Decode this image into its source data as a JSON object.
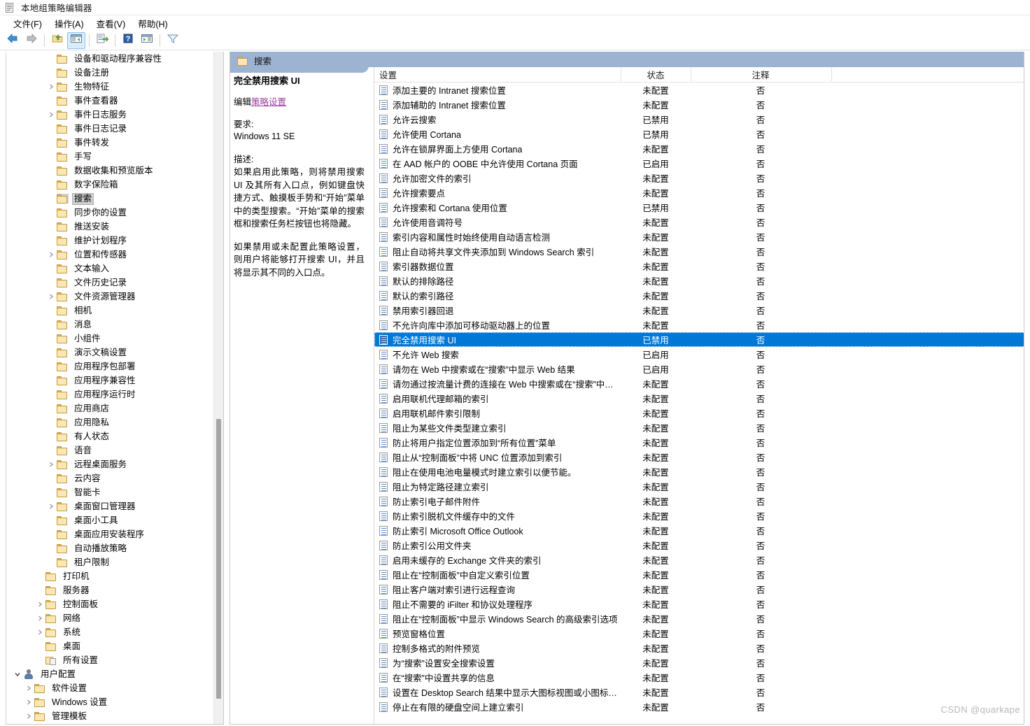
{
  "window": {
    "title": "本地组策略编辑器",
    "title_icon": "policy-editor-icon"
  },
  "menubar": {
    "items": [
      {
        "label": "文件(F)",
        "name": "menu-file"
      },
      {
        "label": "操作(A)",
        "name": "menu-action"
      },
      {
        "label": "查看(V)",
        "name": "menu-view"
      },
      {
        "label": "帮助(H)",
        "name": "menu-help"
      }
    ]
  },
  "toolbar": {
    "buttons": [
      {
        "icon": "back-arrow-icon",
        "name": "toolbar-back"
      },
      {
        "icon": "forward-arrow-icon",
        "name": "toolbar-forward"
      },
      {
        "icon": "up-folder-icon",
        "name": "toolbar-up-level"
      },
      {
        "icon": "show-hide-tree-icon",
        "name": "toolbar-show-hide-tree",
        "active": true
      },
      {
        "icon": "export-list-icon",
        "name": "toolbar-export-list"
      },
      {
        "icon": "help-icon",
        "name": "toolbar-help"
      },
      {
        "icon": "properties-icon",
        "name": "toolbar-properties"
      },
      {
        "icon": "filter-icon",
        "name": "toolbar-filter"
      }
    ]
  },
  "tree": {
    "items": [
      {
        "label": "设备和驱动程序兼容性",
        "indent": 3,
        "expandable": false,
        "icon": "folder-icon"
      },
      {
        "label": "设备注册",
        "indent": 3,
        "expandable": false,
        "icon": "folder-icon"
      },
      {
        "label": "生物特征",
        "indent": 3,
        "expandable": true,
        "icon": "folder-icon"
      },
      {
        "label": "事件查看器",
        "indent": 3,
        "expandable": false,
        "icon": "folder-icon"
      },
      {
        "label": "事件日志服务",
        "indent": 3,
        "expandable": true,
        "icon": "folder-icon"
      },
      {
        "label": "事件日志记录",
        "indent": 3,
        "expandable": false,
        "icon": "folder-icon"
      },
      {
        "label": "事件转发",
        "indent": 3,
        "expandable": false,
        "icon": "folder-icon"
      },
      {
        "label": "手写",
        "indent": 3,
        "expandable": false,
        "icon": "folder-icon"
      },
      {
        "label": "数据收集和预览版本",
        "indent": 3,
        "expandable": false,
        "icon": "folder-icon"
      },
      {
        "label": "数字保险箱",
        "indent": 3,
        "expandable": false,
        "icon": "folder-icon"
      },
      {
        "label": "搜索",
        "indent": 3,
        "expandable": false,
        "icon": "folder-icon",
        "selected": true
      },
      {
        "label": "同步你的设置",
        "indent": 3,
        "expandable": false,
        "icon": "folder-icon"
      },
      {
        "label": "推送安装",
        "indent": 3,
        "expandable": false,
        "icon": "folder-icon"
      },
      {
        "label": "维护计划程序",
        "indent": 3,
        "expandable": false,
        "icon": "folder-icon"
      },
      {
        "label": "位置和传感器",
        "indent": 3,
        "expandable": true,
        "icon": "folder-icon"
      },
      {
        "label": "文本输入",
        "indent": 3,
        "expandable": false,
        "icon": "folder-icon"
      },
      {
        "label": "文件历史记录",
        "indent": 3,
        "expandable": false,
        "icon": "folder-icon"
      },
      {
        "label": "文件资源管理器",
        "indent": 3,
        "expandable": true,
        "icon": "folder-icon"
      },
      {
        "label": "相机",
        "indent": 3,
        "expandable": false,
        "icon": "folder-icon"
      },
      {
        "label": "消息",
        "indent": 3,
        "expandable": false,
        "icon": "folder-icon"
      },
      {
        "label": "小组件",
        "indent": 3,
        "expandable": false,
        "icon": "folder-icon"
      },
      {
        "label": "演示文稿设置",
        "indent": 3,
        "expandable": false,
        "icon": "folder-icon"
      },
      {
        "label": "应用程序包部署",
        "indent": 3,
        "expandable": false,
        "icon": "folder-icon"
      },
      {
        "label": "应用程序兼容性",
        "indent": 3,
        "expandable": false,
        "icon": "folder-icon"
      },
      {
        "label": "应用程序运行时",
        "indent": 3,
        "expandable": false,
        "icon": "folder-icon"
      },
      {
        "label": "应用商店",
        "indent": 3,
        "expandable": false,
        "icon": "folder-icon"
      },
      {
        "label": "应用隐私",
        "indent": 3,
        "expandable": false,
        "icon": "folder-icon"
      },
      {
        "label": "有人状态",
        "indent": 3,
        "expandable": false,
        "icon": "folder-icon"
      },
      {
        "label": "语音",
        "indent": 3,
        "expandable": false,
        "icon": "folder-icon"
      },
      {
        "label": "远程桌面服务",
        "indent": 3,
        "expandable": true,
        "icon": "folder-icon"
      },
      {
        "label": "云内容",
        "indent": 3,
        "expandable": false,
        "icon": "folder-icon"
      },
      {
        "label": "智能卡",
        "indent": 3,
        "expandable": false,
        "icon": "folder-icon"
      },
      {
        "label": "桌面窗口管理器",
        "indent": 3,
        "expandable": true,
        "icon": "folder-icon"
      },
      {
        "label": "桌面小工具",
        "indent": 3,
        "expandable": false,
        "icon": "folder-icon"
      },
      {
        "label": "桌面应用安装程序",
        "indent": 3,
        "expandable": false,
        "icon": "folder-icon"
      },
      {
        "label": "自动播放策略",
        "indent": 3,
        "expandable": false,
        "icon": "folder-icon"
      },
      {
        "label": "租户限制",
        "indent": 3,
        "expandable": false,
        "icon": "folder-icon"
      },
      {
        "label": "打印机",
        "indent": 2,
        "expandable": false,
        "icon": "folder-icon"
      },
      {
        "label": "服务器",
        "indent": 2,
        "expandable": false,
        "icon": "folder-icon"
      },
      {
        "label": "控制面板",
        "indent": 2,
        "expandable": true,
        "icon": "folder-icon"
      },
      {
        "label": "网络",
        "indent": 2,
        "expandable": true,
        "icon": "folder-icon"
      },
      {
        "label": "系统",
        "indent": 2,
        "expandable": true,
        "icon": "folder-icon"
      },
      {
        "label": "桌面",
        "indent": 2,
        "expandable": false,
        "icon": "folder-icon"
      },
      {
        "label": "所有设置",
        "indent": 2,
        "expandable": false,
        "icon": "all-settings-icon"
      },
      {
        "label": "用户配置",
        "indent": 0,
        "expandable": true,
        "expanded": true,
        "icon": "user-config-icon"
      },
      {
        "label": "软件设置",
        "indent": 1,
        "expandable": true,
        "icon": "folder-icon"
      },
      {
        "label": "Windows 设置",
        "indent": 1,
        "expandable": true,
        "icon": "folder-icon"
      },
      {
        "label": "管理模板",
        "indent": 1,
        "expandable": true,
        "icon": "folder-icon"
      }
    ]
  },
  "detail": {
    "header_title": "搜索",
    "header_icon": "folder-icon",
    "policy_title": "完全禁用搜索 UI",
    "edit_prefix": "编辑",
    "edit_link": "策略设置",
    "requirement_label": "要求:",
    "requirement_value": "Windows 11 SE",
    "description_label": "描述:",
    "description_p1": "如果启用此策略，则将禁用搜索 UI 及其所有入口点，例如键盘快捷方式、触摸板手势和“开始”菜单中的类型搜索。“开始”菜单的搜索框和搜索任务栏按钮也将隐藏。",
    "description_p2": "如果禁用或未配置此策略设置，则用户将能够打开搜索 UI，并且将显示其不同的入口点。"
  },
  "list": {
    "columns": {
      "setting": "设置",
      "state": "状态",
      "comment": "注释"
    },
    "rows": [
      {
        "setting": "添加主要的 Intranet 搜索位置",
        "state": "未配置",
        "comment": "否"
      },
      {
        "setting": "添加辅助的 Intranet 搜索位置",
        "state": "未配置",
        "comment": "否"
      },
      {
        "setting": "允许云搜索",
        "state": "已禁用",
        "comment": "否"
      },
      {
        "setting": "允许使用 Cortana",
        "state": "已禁用",
        "comment": "否"
      },
      {
        "setting": "允许在锁屏界面上方使用 Cortana",
        "state": "未配置",
        "comment": "否"
      },
      {
        "setting": "在 AAD 帐户的 OOBE 中允许使用 Cortana 页面",
        "state": "已启用",
        "comment": "否"
      },
      {
        "setting": "允许加密文件的索引",
        "state": "未配置",
        "comment": "否"
      },
      {
        "setting": "允许搜索要点",
        "state": "未配置",
        "comment": "否"
      },
      {
        "setting": "允许搜索和 Cortana 使用位置",
        "state": "已禁用",
        "comment": "否"
      },
      {
        "setting": "允许使用音调符号",
        "state": "未配置",
        "comment": "否"
      },
      {
        "setting": "索引内容和属性时始终使用自动语言检测",
        "state": "未配置",
        "comment": "否"
      },
      {
        "setting": "阻止自动将共享文件夹添加到 Windows Search 索引",
        "state": "未配置",
        "comment": "否"
      },
      {
        "setting": "索引器数据位置",
        "state": "未配置",
        "comment": "否"
      },
      {
        "setting": "默认的排除路径",
        "state": "未配置",
        "comment": "否"
      },
      {
        "setting": "默认的索引路径",
        "state": "未配置",
        "comment": "否"
      },
      {
        "setting": "禁用索引器回退",
        "state": "未配置",
        "comment": "否"
      },
      {
        "setting": "不允许向库中添加可移动驱动器上的位置",
        "state": "未配置",
        "comment": "否"
      },
      {
        "setting": "完全禁用搜索 UI",
        "state": "已禁用",
        "comment": "否",
        "selected": true
      },
      {
        "setting": "不允许 Web 搜索",
        "state": "已启用",
        "comment": "否"
      },
      {
        "setting": "请勿在 Web 中搜索或在“搜索”中显示 Web 结果",
        "state": "已启用",
        "comment": "否"
      },
      {
        "setting": "请勿通过按流量计费的连接在 Web 中搜索或在“搜索”中显...",
        "state": "未配置",
        "comment": "否"
      },
      {
        "setting": "启用联机代理邮箱的索引",
        "state": "未配置",
        "comment": "否"
      },
      {
        "setting": "启用联机邮件索引限制",
        "state": "未配置",
        "comment": "否"
      },
      {
        "setting": "阻止为某些文件类型建立索引",
        "state": "未配置",
        "comment": "否"
      },
      {
        "setting": "防止将用户指定位置添加到“所有位置”菜单",
        "state": "未配置",
        "comment": "否"
      },
      {
        "setting": "阻止从“控制面板”中将 UNC 位置添加到索引",
        "state": "未配置",
        "comment": "否"
      },
      {
        "setting": "阻止在使用电池电量模式时建立索引以便节能。",
        "state": "未配置",
        "comment": "否"
      },
      {
        "setting": "阻止为特定路径建立索引",
        "state": "未配置",
        "comment": "否"
      },
      {
        "setting": "防止索引电子邮件附件",
        "state": "未配置",
        "comment": "否"
      },
      {
        "setting": "防止索引脱机文件缓存中的文件",
        "state": "未配置",
        "comment": "否"
      },
      {
        "setting": "防止索引 Microsoft Office Outlook",
        "state": "未配置",
        "comment": "否"
      },
      {
        "setting": "防止索引公用文件夹",
        "state": "未配置",
        "comment": "否"
      },
      {
        "setting": "启用未缓存的 Exchange 文件夹的索引",
        "state": "未配置",
        "comment": "否"
      },
      {
        "setting": "阻止在“控制面板”中自定义索引位置",
        "state": "未配置",
        "comment": "否"
      },
      {
        "setting": "阻止客户端对索引进行远程查询",
        "state": "未配置",
        "comment": "否"
      },
      {
        "setting": "阻止不需要的 iFilter 和协议处理程序",
        "state": "未配置",
        "comment": "否"
      },
      {
        "setting": "阻止在“控制面板”中显示 Windows Search 的高级索引选项",
        "state": "未配置",
        "comment": "否"
      },
      {
        "setting": "预览窗格位置",
        "state": "未配置",
        "comment": "否"
      },
      {
        "setting": "控制多格式的附件预览",
        "state": "未配置",
        "comment": "否"
      },
      {
        "setting": "为“搜索”设置安全搜索设置",
        "state": "未配置",
        "comment": "否"
      },
      {
        "setting": "在“搜索”中设置共享的信息",
        "state": "未配置",
        "comment": "否"
      },
      {
        "setting": "设置在 Desktop Search 结果中显示大图标视图或小图标视...",
        "state": "未配置",
        "comment": "否"
      },
      {
        "setting": "停止在有限的硬盘空间上建立索引",
        "state": "未配置",
        "comment": "否"
      }
    ]
  },
  "watermark": {
    "text": "CSDN @quarkape"
  }
}
